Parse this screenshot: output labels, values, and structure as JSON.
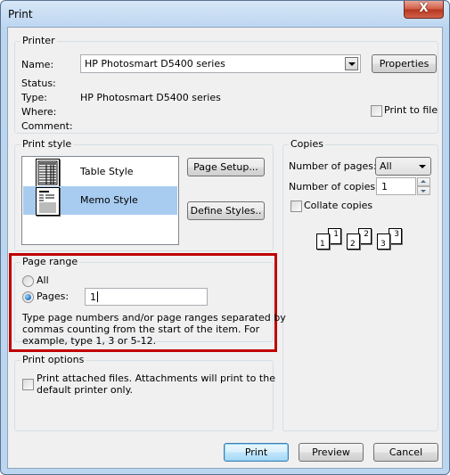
{
  "window": {
    "title": "Print",
    "close_label": "X"
  },
  "printer": {
    "group_label": "Printer",
    "name_label": "Name:",
    "name_value": "HP Photosmart D5400 series",
    "properties_label": "Properties",
    "status_label": "Status:",
    "status_value": "",
    "type_label": "Type:",
    "type_value": "HP Photosmart D5400 series",
    "where_label": "Where:",
    "where_value": "",
    "comment_label": "Comment:",
    "comment_value": "",
    "print_to_file_label": "Print to file",
    "print_to_file_checked": false
  },
  "print_style": {
    "group_label": "Print style",
    "items": [
      {
        "label": "Table Style",
        "icon": "table-style-icon",
        "selected": false
      },
      {
        "label": "Memo Style",
        "icon": "memo-style-icon",
        "selected": true
      }
    ],
    "page_setup_label": "Page Setup...",
    "define_styles_label": "Define Styles.."
  },
  "copies": {
    "group_label": "Copies",
    "pages_label": "Number of pages:",
    "pages_value": "All",
    "copies_label": "Number of copies:",
    "copies_value": "1",
    "collate_label": "Collate copies",
    "collate_checked": false,
    "collate_pages": [
      "1",
      "1",
      "2",
      "2",
      "3",
      "3"
    ]
  },
  "page_range": {
    "group_label": "Page range",
    "all_label": "All",
    "pages_label": "Pages:",
    "selected": "pages",
    "pages_value": "1",
    "help_text_1": "Type page numbers and/or page ranges separated by",
    "help_text_2": "commas counting from the start of the item.  For",
    "help_text_3": "example, type 1, 3 or 5-12.",
    "highlight_color": "#c00000"
  },
  "print_options": {
    "group_label": "Print options",
    "attach_label_1": "Print attached files.  Attachments will print to the",
    "attach_label_2": "default printer only.",
    "attach_checked": false
  },
  "footer": {
    "print_label": "Print",
    "preview_label": "Preview",
    "cancel_label": "Cancel"
  }
}
